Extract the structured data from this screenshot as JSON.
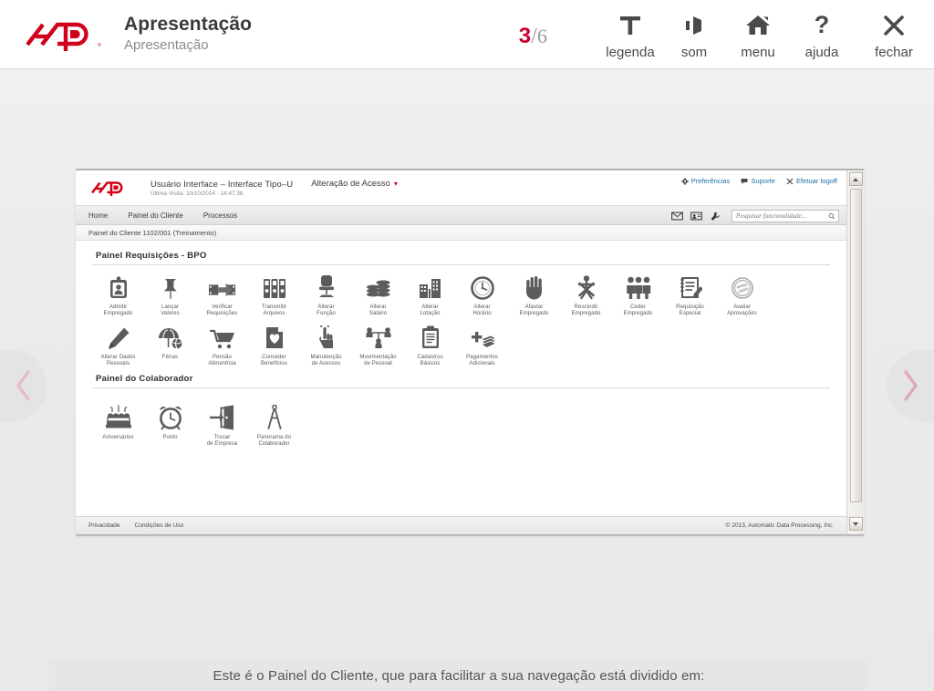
{
  "player": {
    "brand": "ADP",
    "title": "Apresentação",
    "subtitle": "Apresentação",
    "slide_current": "3",
    "slide_separator": "/",
    "slide_total": "6",
    "accent_red": "#cc0033",
    "tools": [
      {
        "icon": "caption-T-icon",
        "label": "legenda"
      },
      {
        "icon": "speaker-sound-icon",
        "label": "som"
      },
      {
        "icon": "home-menu-icon",
        "label": "menu"
      },
      {
        "icon": "question-mark-help-icon",
        "label": "ajuda"
      },
      {
        "icon": "close-x-icon",
        "label": "fechar"
      }
    ],
    "nav": {
      "prev_icon": "chevron-left-icon",
      "next_icon": "chevron-right-icon"
    },
    "caption": "Este é o Painel do Cliente, que para facilitar a sua navegação está dividido em:"
  },
  "app": {
    "brand": "ADP",
    "user_line": "Usuário Interface – Interface Tipo–U",
    "last_visit": "Última Visita: 10/10/2014 - 14:47:38",
    "access_change": "Alteração de Acesso",
    "header_links": [
      {
        "icon": "gear-icon",
        "label": "Preferências"
      },
      {
        "icon": "chat-bubble-icon",
        "label": "Suporte"
      },
      {
        "icon": "close-x-icon",
        "label": "Efetuar logoff"
      }
    ],
    "menu_items": [
      "Home",
      "Painel do Cliente",
      "Processos"
    ],
    "menu_icons": [
      "envelope-mail-icon",
      "id-card-icon",
      "wrench-tools-icon"
    ],
    "search": {
      "placeholder": "Pesquisar funcionalidade...",
      "icon": "search-icon"
    },
    "breadcrumb": "Painel do Cliente 1102/001 (Treinamento)",
    "section_requisicoes": {
      "title": "Painel Requisições - BPO",
      "row1": [
        {
          "icon": "id-badge-icon",
          "l1": "Admitir",
          "l2": "Empregado"
        },
        {
          "icon": "pushpin-icon",
          "l1": "Lançar",
          "l2": "Valores"
        },
        {
          "icon": "film-arrow-icon",
          "l1": "Verificar",
          "l2": "Requisições"
        },
        {
          "icon": "binders-files-icon",
          "l1": "Transmitir",
          "l2": "Arquivos"
        },
        {
          "icon": "office-chair-icon",
          "l1": "Alterar",
          "l2": "Função"
        },
        {
          "icon": "coin-stacks-icon",
          "l1": "Alterar",
          "l2": "Salário"
        },
        {
          "icon": "buildings-icon",
          "l1": "Alterar",
          "l2": "Lotação"
        },
        {
          "icon": "clock-icon",
          "l1": "Alterar",
          "l2": "Horário"
        },
        {
          "icon": "hand-stop-icon",
          "l1": "Afastar",
          "l2": "Empregado"
        },
        {
          "icon": "person-crossed-icon",
          "l1": "Rescindir",
          "l2": "Empregado"
        },
        {
          "icon": "three-people-icon",
          "l1": "Ceder",
          "l2": "Empregado"
        },
        {
          "icon": "notepad-pencil-icon",
          "l1": "Requisição",
          "l2": "Especial"
        },
        {
          "icon": "approved-stamp-icon",
          "l1": "Avaliar",
          "l2": "Aprovações"
        }
      ],
      "row2": [
        {
          "icon": "pen-icon",
          "l1": "Alterar Dados",
          "l2": "Pessoais"
        },
        {
          "icon": "umbrella-beachball-icon",
          "l1": "Férias",
          "l2": ""
        },
        {
          "icon": "shopping-cart-icon",
          "l1": "Pensão",
          "l2": "Alimentícia"
        },
        {
          "icon": "heart-card-icon",
          "l1": "Conceder",
          "l2": "Benefícios"
        },
        {
          "icon": "hand-click-icon",
          "l1": "Manutenção",
          "l2": "de Acessos"
        },
        {
          "icon": "people-network-icon",
          "l1": "Movimentação",
          "l2": "de Pessoal"
        },
        {
          "icon": "clipboard-icon",
          "l1": "Cadastros",
          "l2": "Básicos"
        },
        {
          "icon": "plus-money-icon",
          "l1": "Pagamentos",
          "l2": "Adicionais"
        }
      ]
    },
    "section_colaborador": {
      "title": "Painel do Colaborador",
      "row1": [
        {
          "icon": "birthday-cake-icon",
          "l1": "Aniversários",
          "l2": ""
        },
        {
          "icon": "alarm-clock-icon",
          "l1": "Ponto",
          "l2": ""
        },
        {
          "icon": "exit-door-icon",
          "l1": "Trocar",
          "l2": "de Empresa"
        },
        {
          "icon": "compass-divider-icon",
          "l1": "Panorama do",
          "l2": "Colaborador"
        }
      ]
    },
    "footer": {
      "links": [
        "Privacidade",
        "Condições de Uso"
      ],
      "copyright": "© 2013, Automatic Data Processing, Inc."
    }
  }
}
